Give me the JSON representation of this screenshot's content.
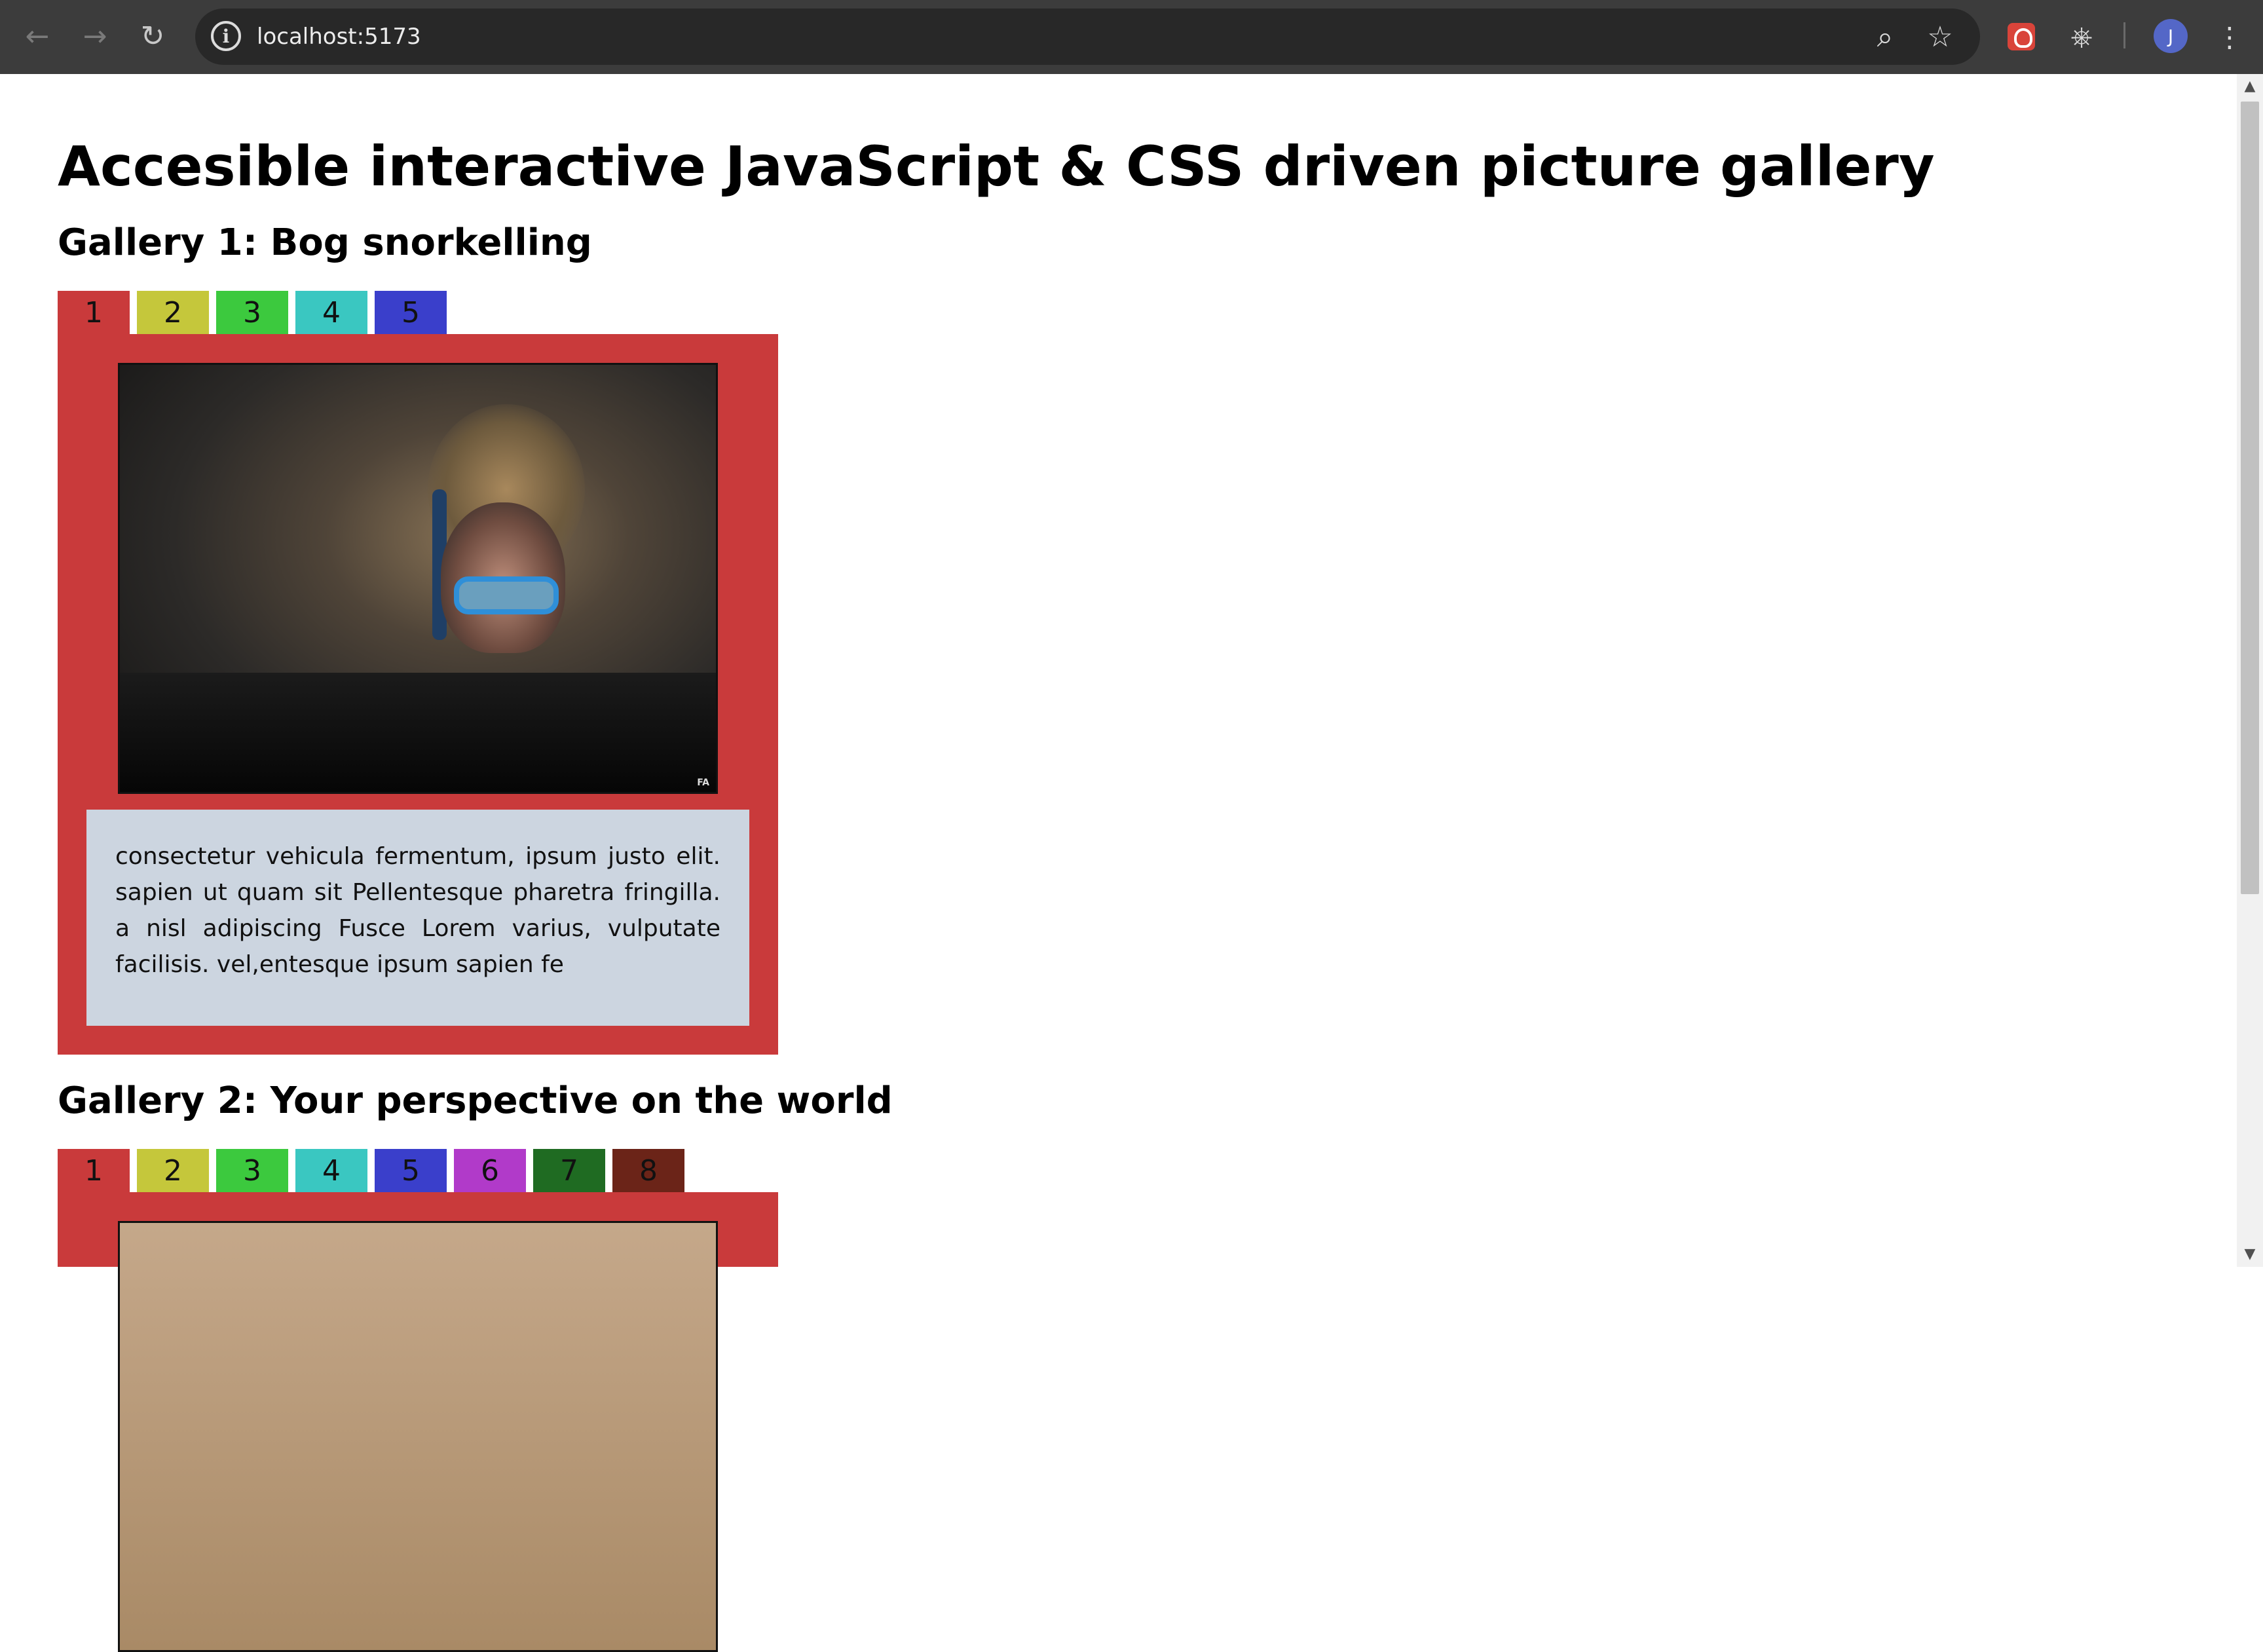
{
  "browser": {
    "url": "localhost:5173",
    "avatar_initial": "J"
  },
  "page": {
    "title": "Accesible interactive JavaScript & CSS driven picture gallery"
  },
  "galleries": [
    {
      "title": "Gallery 1: Bog snorkelling",
      "active_tab": "1",
      "tabs": [
        {
          "label": "1",
          "color": "#c93a3b"
        },
        {
          "label": "2",
          "color": "#c5c73b"
        },
        {
          "label": "3",
          "color": "#3cc93e"
        },
        {
          "label": "4",
          "color": "#3ac7c1"
        },
        {
          "label": "5",
          "color": "#3a3fcb"
        }
      ],
      "panel_color": "#c93a3b",
      "image_credit": "FA",
      "caption": "consectetur vehicula fermentum, ipsum justo elit. sapien ut quam sit Pellentesque pharetra fringilla. a nisl adipiscing Fusce Lorem varius, vulputate facilisis. vel,entesque ipsum sapien fe"
    },
    {
      "title": "Gallery 2: Your perspective on the world",
      "active_tab": "1",
      "tabs": [
        {
          "label": "1",
          "color": "#c93a3b"
        },
        {
          "label": "2",
          "color": "#c5c73b"
        },
        {
          "label": "3",
          "color": "#3cc93e"
        },
        {
          "label": "4",
          "color": "#3ac7c1"
        },
        {
          "label": "5",
          "color": "#3a3fcb"
        },
        {
          "label": "6",
          "color": "#b13ac9"
        },
        {
          "label": "7",
          "color": "#1f6b22"
        },
        {
          "label": "8",
          "color": "#6b2418"
        }
      ],
      "panel_color": "#c93a3b"
    }
  ]
}
